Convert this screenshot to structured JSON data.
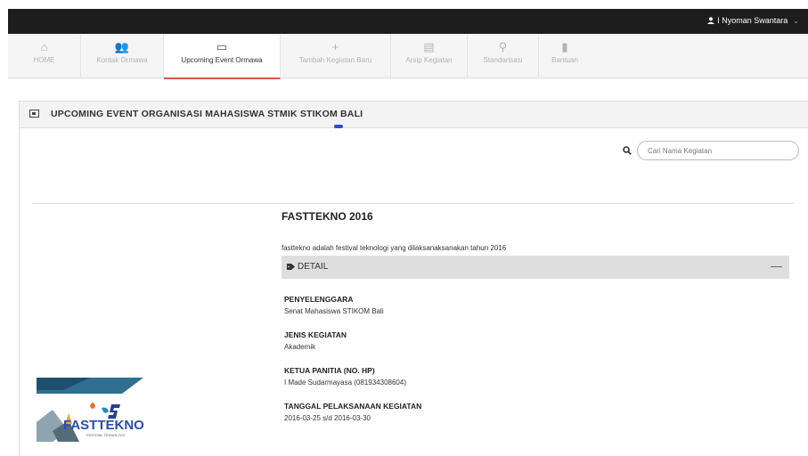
{
  "header": {
    "user_name": "I Nyoman Swantara",
    "user_icon": "user-icon",
    "caret": "⌄"
  },
  "nav": {
    "items": [
      {
        "label": "HOME",
        "icon": "home-icon",
        "glyph": "⌂"
      },
      {
        "label": "Kontak Ormawa",
        "icon": "users-icon",
        "glyph": "👥"
      },
      {
        "label": "Upcoming Event Ormawa",
        "icon": "calendar-card-icon",
        "glyph": "▭"
      },
      {
        "label": "Tambah Kegiatan Baru",
        "icon": "plus-icon",
        "glyph": "+"
      },
      {
        "label": "Arsip Kegiatan",
        "icon": "book-icon",
        "glyph": "▤"
      },
      {
        "label": "Standarisasi",
        "icon": "paperclip-icon",
        "glyph": "⚲"
      },
      {
        "label": "Bantuan",
        "icon": "bookmark-icon",
        "glyph": "▮"
      }
    ],
    "active_index": 2
  },
  "panel": {
    "title": "UPCOMING EVENT ORGANISASI MAHASISWA STMIK STIKOM BALI",
    "icon": "calendar-icon"
  },
  "search": {
    "placeholder": "Cari Nama Kegiatan",
    "value": "",
    "icon": "search-icon"
  },
  "event": {
    "title": "FASTTEKNO 2016",
    "description": "fasttekno adalah festival teknologi yang dilaksanaksanakan tahun 2016",
    "detail_label": "DETAIL",
    "detail_icon": "tags-icon",
    "collapse_glyph": "—",
    "logo_text": "FASTTEKNO",
    "logo_subtext": "FESTIVAL TEKNOLOGI",
    "fields": [
      {
        "key": "PENYELENGGARA",
        "value": "Senat Mahasiswa STIKOM Bali"
      },
      {
        "key": "JENIS KEGIATAN",
        "value": "Akademik"
      },
      {
        "key": "KETUA PANITIA (NO. HP)",
        "value": "I Made Sudarmayasa (081934308604)"
      },
      {
        "key": "TANGGAL PELAKSANAAN KEGIATAN",
        "value": "2016-03-25 s/d 2016-03-30"
      }
    ]
  },
  "colors": {
    "topbar": "#1d1d1d",
    "active_tab_underline": "#d9534f",
    "panel_marker": "#2a4dd6",
    "detail_bar": "#dedede"
  }
}
